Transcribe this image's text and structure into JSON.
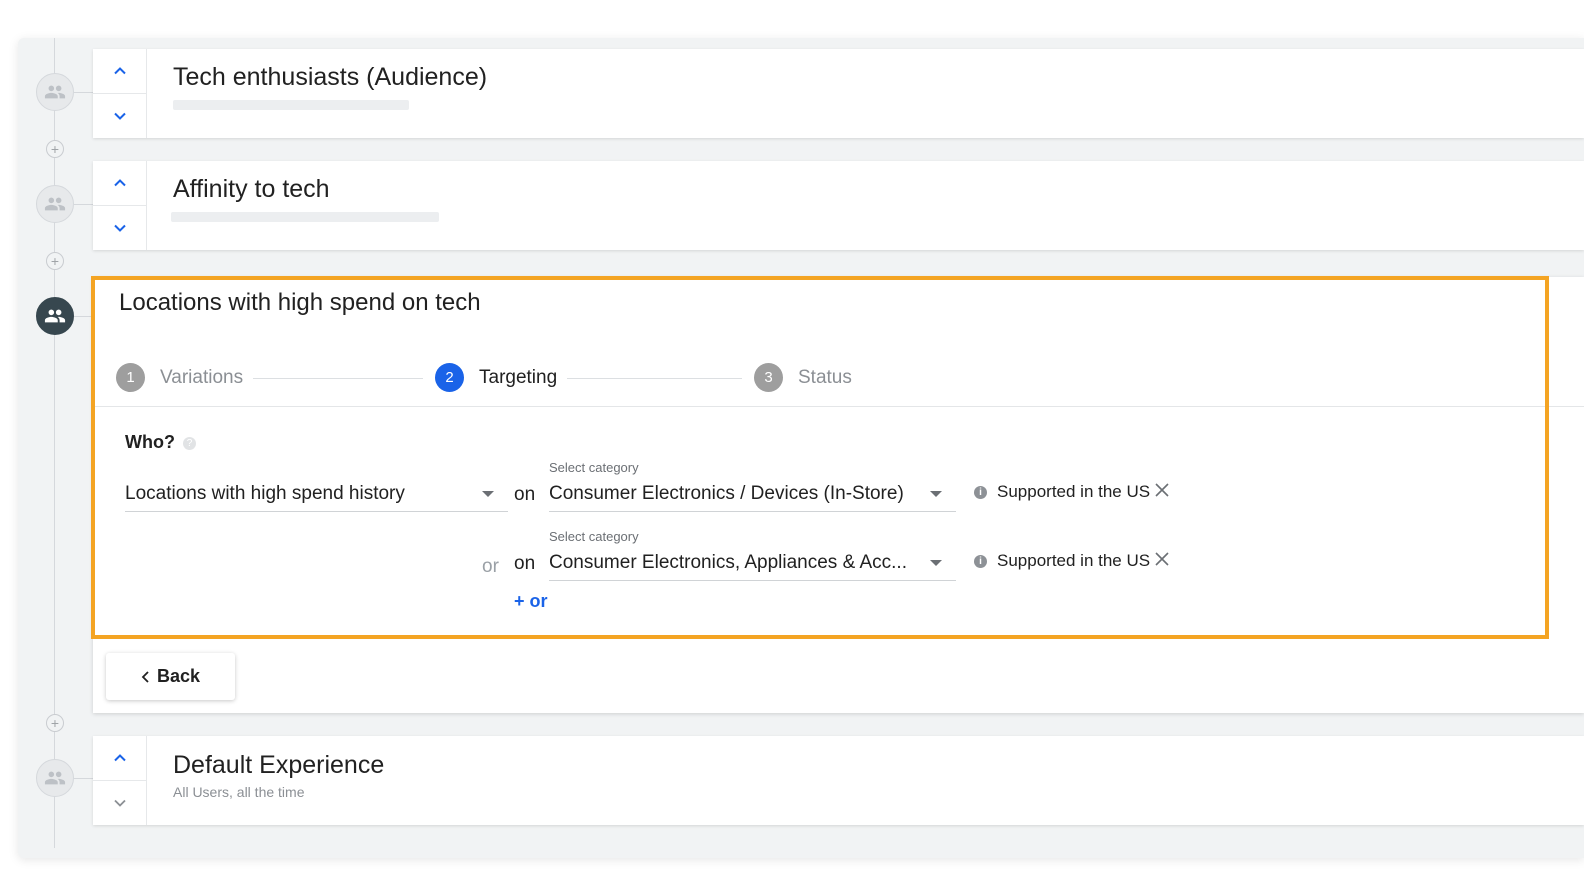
{
  "experiences": [
    {
      "title": "Tech enthusiasts (Audience)"
    },
    {
      "title": "Affinity to tech"
    }
  ],
  "active": {
    "title": "Locations with high spend on tech",
    "steps": [
      {
        "num": "1",
        "label": "Variations"
      },
      {
        "num": "2",
        "label": "Targeting"
      },
      {
        "num": "3",
        "label": "Status"
      }
    ],
    "who_label": "Who?",
    "condition": {
      "value": "Locations with high spend history"
    },
    "rules": [
      {
        "prefix": "",
        "on": "on",
        "category_label": "Select category",
        "category_value": "Consumer Electronics / Devices (In-Store)",
        "supported": "Supported in the US"
      },
      {
        "prefix": "or",
        "on": "on",
        "category_label": "Select category",
        "category_value": "Consumer Electronics, Appliances & Acc...",
        "supported": "Supported in the US"
      }
    ],
    "add_or": "+ or",
    "back": "Back"
  },
  "default_experience": {
    "title": "Default Experience",
    "subtitle": "All Users, all the time"
  },
  "colors": {
    "accent": "#1a63e8",
    "highlight": "#f4a423",
    "active_node": "#37474f"
  }
}
